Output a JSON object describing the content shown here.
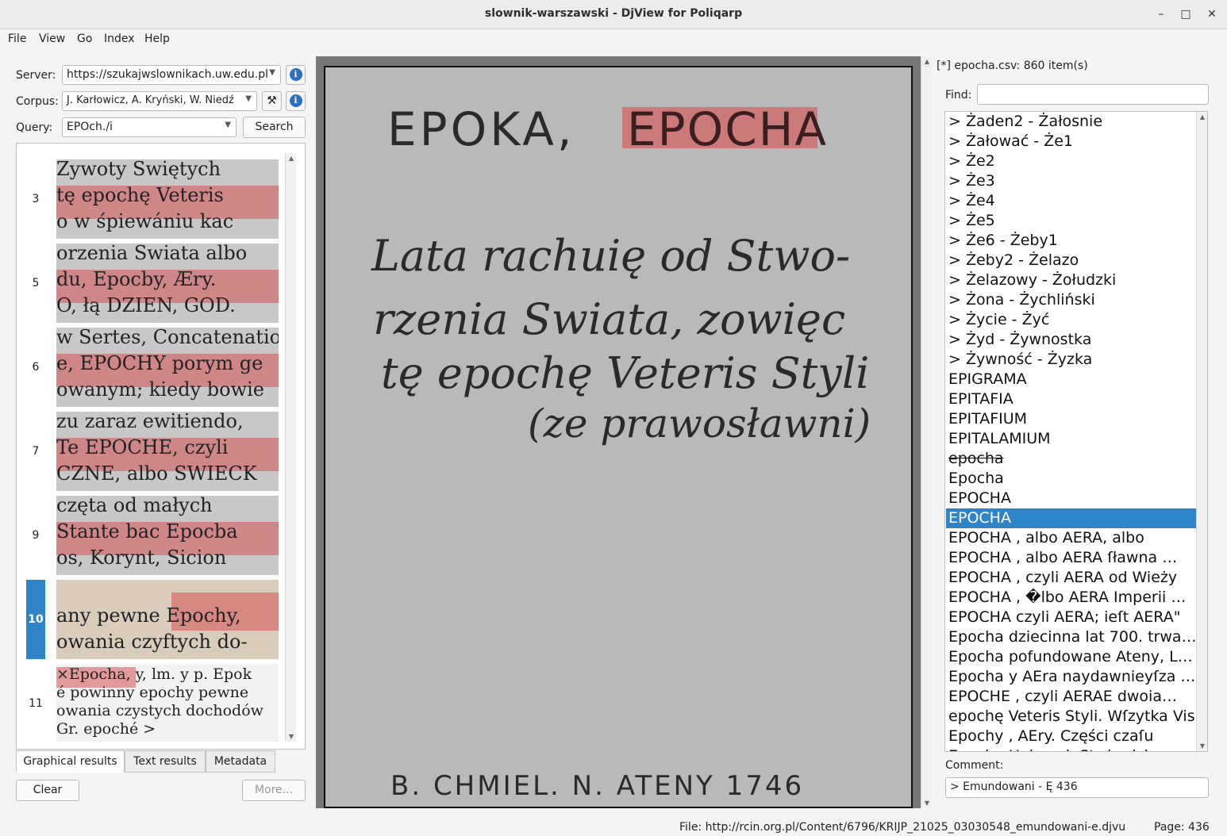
{
  "window": {
    "title": "slownik-warszawski - DjView for Poliqarp"
  },
  "menu": [
    "File",
    "View",
    "Go",
    "Index",
    "Help"
  ],
  "search": {
    "server_label": "Server:",
    "server_value": "https://szukajwslownikach.uw.edu.pl",
    "corpus_label": "Corpus:",
    "corpus_value": "J. Karłowicz, A. Kryński, W. Niedź",
    "query_label": "Query:",
    "query_value": "EPOch./i",
    "search_button": "Search"
  },
  "results": [
    {
      "num": "3",
      "lines": [
        "Zywoty Swiętych",
        "tę epochę Veteris",
        "o w śpiewániu kac"
      ],
      "selected": false
    },
    {
      "num": "5",
      "lines": [
        "orzenia Swiata albo",
        "du, Epocby, Æry.",
        "O, łą DZIEN, GOD."
      ],
      "selected": false
    },
    {
      "num": "6",
      "lines": [
        "w Sertes, Concatenatio.",
        "e, EPOCHY porym ge",
        "owanym; kiedy bowie"
      ],
      "selected": false
    },
    {
      "num": "7",
      "lines": [
        "zu zaraz ewitiendo,",
        "Te EPOCHE, czyli",
        "CZNE, albo SWIECK"
      ],
      "selected": false
    },
    {
      "num": "9",
      "lines": [
        "częta od małych",
        "Stante bac Epocba",
        "os, Korynt, Sicion"
      ],
      "selected": false
    },
    {
      "num": "10",
      "lines": [
        "",
        "any pewne  Epochy,",
        "owania czyftych do-"
      ],
      "selected": true
    },
    {
      "num": "11",
      "lines": [
        "×Epocha, y, lm. y p. Epok",
        "é powinny epochy pewne",
        "owania czystych dochodów",
        "Gr. epoché >"
      ],
      "selected": false
    }
  ],
  "tabs": [
    "Graphical results",
    "Text results",
    "Metadata"
  ],
  "buttons": {
    "clear": "Clear",
    "more": "More..."
  },
  "page_card": {
    "line1a": "EPOKA,",
    "line1b": "EPOCHA",
    "line2": "Lata rachuię od Stwo-",
    "line3": "rzenia Swiata, zowięc",
    "line4": "tę epochę Veteris Styli",
    "line5": "(ze prawosławni)",
    "footer": "B. CHMIEL. N. ATENY 1746"
  },
  "index": {
    "header": "[*] epocha.csv: 860 item(s)",
    "find_label": "Find:",
    "find_value": "",
    "items": [
      "> Żaden2 - Żałosnie",
      "> Żałować - Że1",
      "> Że2",
      "> Że3",
      "> Że4",
      "> Że5",
      "> Że6 - Żeby1",
      "> Żeby2 - Żelazo",
      "> Żelazowy - Żołudzki",
      "> Żona - Żychliński",
      "> Życie - Żyć",
      "> Żyd - Żywnostka",
      "> Żywność - Żyzka",
      "EPIGRAMA",
      "EPITAFIA",
      "EPITAFIUM",
      "EPITALAMIUM",
      "epocha",
      "Epocha",
      "EPOCHA",
      "EPOCHA",
      "EPOCHA , albo AERA, albo",
      "EPOCHA , albo AERA ſławna …",
      "EPOCHA , czyli AERA od Wieży",
      "EPOCHA , �lbo AERA Imperii …",
      "EPOCHA czyli AERA; ieſt AERA\"",
      "Epocha dziecinna lat 700. trwa…",
      "Epocha pofundowane Ateny, L…",
      "Epocha y AEra naydawnieyſza …",
      "EPOCHE , czyli AERAE dwoia…",
      "epochę Veteris Styli. Wſzytka Vis",
      "Epochy , AEry. Części czaſu",
      "Epocha Universi. Stwierdzi…"
    ],
    "selected_index": 20,
    "strike_index": 17,
    "comment_label": "Comment:",
    "comment_value": "> Emundowani - Ę 436"
  },
  "status": {
    "file": "File: http://rcin.org.pl/Content/6796/KRIJP_21025_03030548_emundowani-e.djvu",
    "page": "Page: 436"
  }
}
